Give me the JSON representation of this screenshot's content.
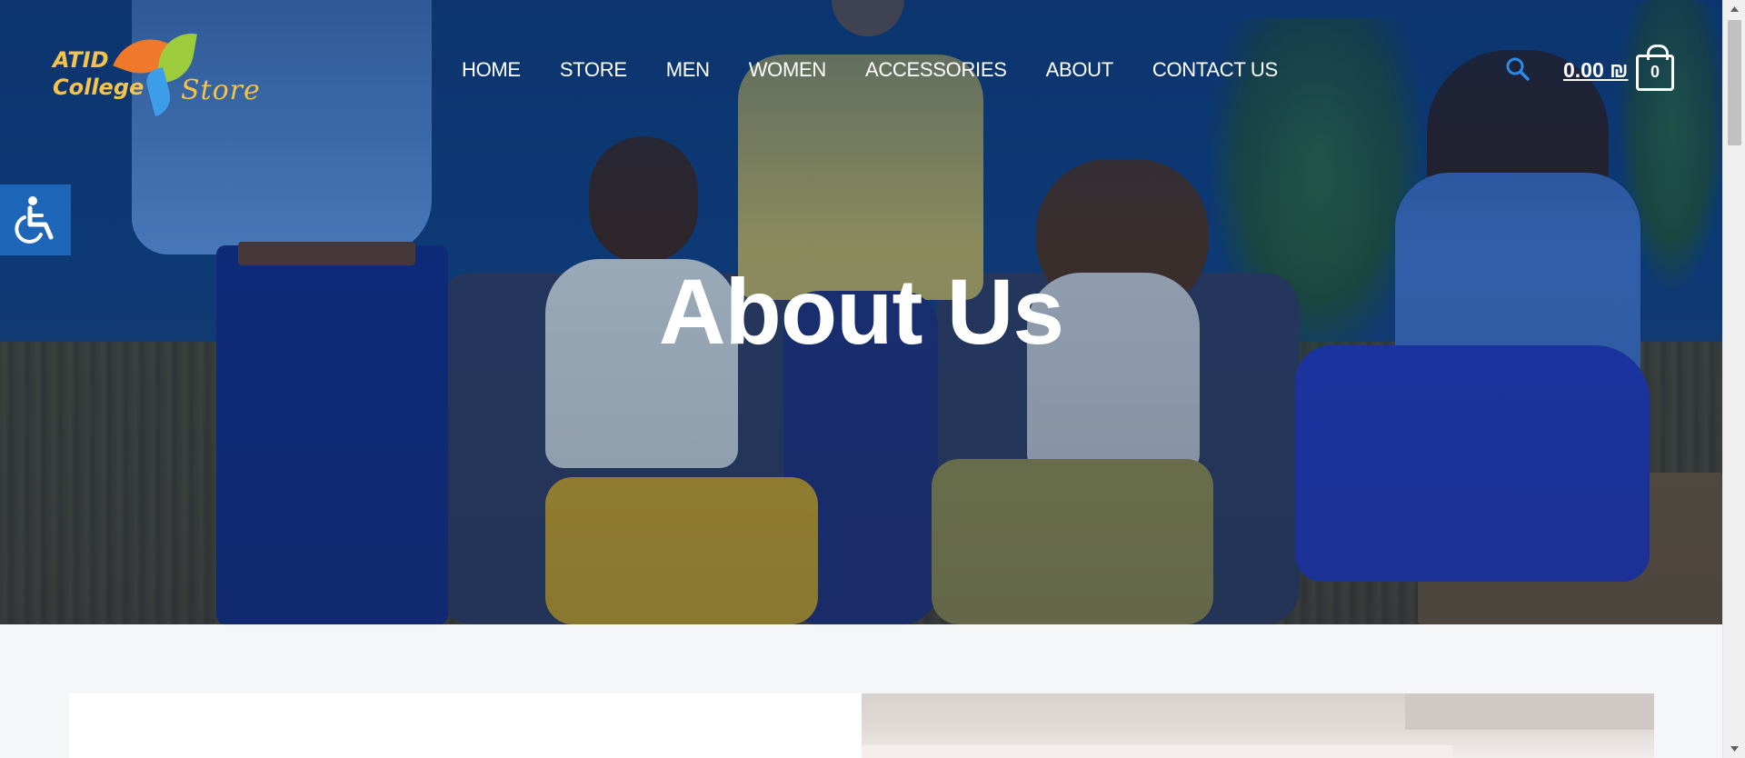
{
  "logo": {
    "line1": "ATID",
    "line2": "College",
    "line3": "Store"
  },
  "nav": {
    "items": [
      "HOME",
      "STORE",
      "MEN",
      "WOMEN",
      "ACCESSORIES",
      "ABOUT",
      "CONTACT US"
    ]
  },
  "header": {
    "search_icon": "search-icon",
    "cart_total": "0.00 ₪",
    "cart_count": "0",
    "cart_icon": "shopping-bag-icon"
  },
  "accessibility": {
    "icon": "wheelchair-icon"
  },
  "hero": {
    "title": "About Us"
  },
  "colors": {
    "accent": "#1e66b8",
    "logo_text": "#f6c24a",
    "hero_overlay": "#0d3e80",
    "page_background": "#f5f6f8"
  }
}
